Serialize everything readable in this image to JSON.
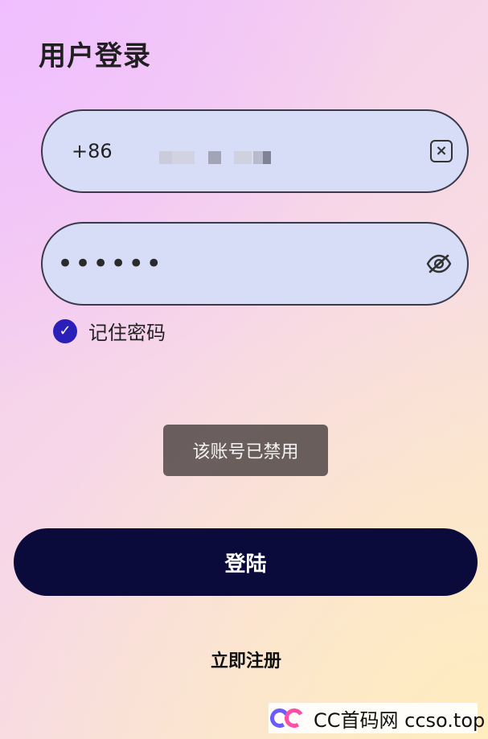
{
  "header": {
    "title": "用户登录"
  },
  "phone_field": {
    "prefix": "+86"
  },
  "password_field": {
    "value": "••••••"
  },
  "remember": {
    "label": "记住密码",
    "checked": true
  },
  "toast": {
    "message": "该账号已禁用"
  },
  "actions": {
    "login_label": "登陆",
    "register_label": "立即注册"
  },
  "watermark": {
    "text": "CC首码网 ccso.top"
  },
  "icons": {
    "clear": "close-icon",
    "visibility": "eye-off-icon",
    "checkbox": "check-icon"
  },
  "colors": {
    "primary_button": "#0a0b3a",
    "input_fill": "#d7dcf7",
    "checkbox": "#2a1fb8",
    "toast": "#625656"
  }
}
